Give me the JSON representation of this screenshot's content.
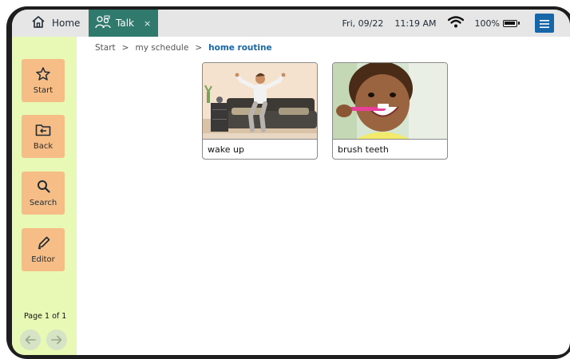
{
  "tabs": {
    "home": {
      "label": "Home",
      "icon": "house-icon"
    },
    "talk": {
      "label": "Talk",
      "icon": "people-talk-icon",
      "close": "×"
    }
  },
  "status": {
    "date": "Fri, 09/22",
    "time": "11:19 AM",
    "wifi_icon": "wifi-icon",
    "battery_label": "100%",
    "battery_level": 1.0
  },
  "menu_icon": "hamburger-menu-icon",
  "sidebar": {
    "items": [
      {
        "label": "Start",
        "icon": "star-icon"
      },
      {
        "label": "Back",
        "icon": "folder-back-icon"
      },
      {
        "label": "Search",
        "icon": "search-icon"
      },
      {
        "label": "Editor",
        "icon": "pencil-icon"
      }
    ],
    "page_label": "Page 1 of 1"
  },
  "breadcrumb": {
    "items": [
      "Start",
      "my schedule"
    ],
    "separator": ">",
    "current": "home routine"
  },
  "cards": [
    {
      "label": "wake up",
      "image": "person-stretching-on-bed"
    },
    {
      "label": "brush teeth",
      "image": "child-brushing-teeth"
    }
  ],
  "colors": {
    "talk_tab": "#2f7a6c",
    "sidebar_bg": "#e8f9b5",
    "sidebar_button": "#f6bd87",
    "accent_blue": "#1767a8"
  }
}
